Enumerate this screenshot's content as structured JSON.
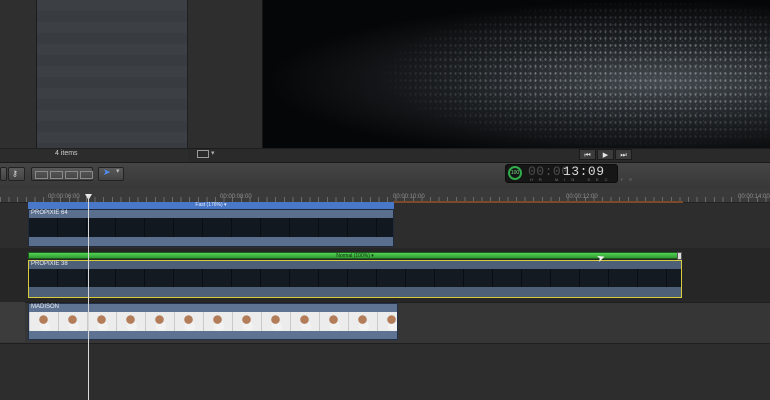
{
  "browser": {
    "items_count": "4 items"
  },
  "viewer": {
    "display_caret": "▾",
    "transport": {
      "prev": "⏮",
      "play": "▶",
      "next": "⏭"
    }
  },
  "toolbar": {
    "select_tool_icon": "select-arrow-icon",
    "select_tool_caret": "▾"
  },
  "dashboard": {
    "percent": "100",
    "timecode_dim": "00:00",
    "timecode_bright": "13:09",
    "units": "HR MIN SEC FR"
  },
  "ruler": {
    "labels": [
      "00:00:06:00",
      "00:00:08:00",
      "00:00:10:00",
      "00:00:12:00",
      "00:00:14:00"
    ]
  },
  "clips": [
    {
      "name": "PROPIXIE 64",
      "speed": "Fast (176%) ▾"
    },
    {
      "name": "PROPIXIE 38",
      "speed": "Normal (100%) ▾"
    },
    {
      "name": "MADISON"
    }
  ],
  "colors": {
    "fast_speed": "#4a78c8",
    "normal_speed": "#3fb43f",
    "selection_border": "#d8cc3a",
    "dashboard_green": "#2fae4a"
  }
}
